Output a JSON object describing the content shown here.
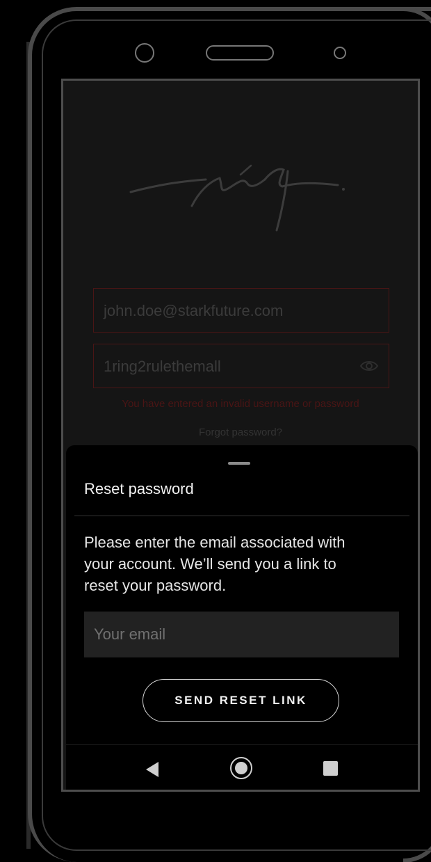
{
  "login": {
    "email_value": "john.doe@starkfuture.com",
    "password_value": "1ring2rulethemall",
    "error_message": "You have entered an invalid username or password",
    "forgot_password": "Forgot password?"
  },
  "reset_sheet": {
    "title": "Reset password",
    "description": "Please enter the email associated with your account. We’ll send you a link to reset your password.",
    "email_placeholder": "Your email",
    "email_value": "",
    "send_button": "SEND RESET LINK"
  },
  "icons": {
    "logo": "signature-logo",
    "password_toggle": "eye-icon",
    "nav_back": "back-triangle-icon",
    "nav_home": "home-circle-icon",
    "nav_recent": "recent-square-icon"
  },
  "colors": {
    "background": "#000000",
    "screen": "#151515",
    "error": "#4a1515",
    "sheet": "#000000",
    "input": "#222222"
  }
}
